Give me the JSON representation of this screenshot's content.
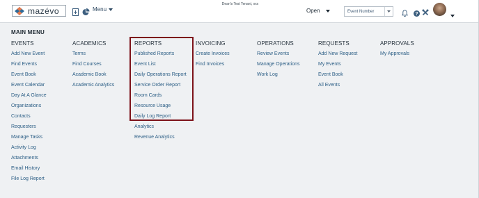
{
  "header": {
    "logo_text": "mazévo",
    "menu_label": "Menu",
    "tenant": "Dean's Test Tenant, xxx",
    "status_value": "Open",
    "search_placeholder": "Event Number"
  },
  "colors": {
    "link": "#2d5f86",
    "highlight": "#7d1219",
    "logo_orange": "#e8794a",
    "logo_blue": "#2e6c9a"
  },
  "main_menu": {
    "title": "MAIN MENU",
    "columns": [
      {
        "heading": "EVENTS",
        "items": [
          "Add New Event",
          "Find Events",
          "Event Book",
          "Event Calendar",
          "Day At A Glance",
          "Organizations",
          "Contacts",
          "Requesters",
          "Manage Tasks",
          "Activity Log",
          "Attachments",
          "Email History",
          "File Log Report"
        ]
      },
      {
        "heading": "ACADEMICS",
        "items": [
          "Terms",
          "Find Courses",
          "Academic Book",
          "Academic Analytics"
        ]
      },
      {
        "heading": "REPORTS",
        "items": [
          "Published Reports",
          "Event List",
          "Daily Operations Report",
          "Service Order Report",
          "Room Cards",
          "Resource Usage",
          "Daily Log Report",
          "Analytics",
          "Revenue Analytics"
        ]
      },
      {
        "heading": "INVOICING",
        "items": [
          "Create Invoices",
          "Find Invoices"
        ]
      },
      {
        "heading": "OPERATIONS",
        "items": [
          "Review Events",
          "Manage Operations",
          "Work Log"
        ]
      },
      {
        "heading": "REQUESTS",
        "items": [
          "Add New Request",
          "My Events",
          "Event Book",
          "All Events"
        ]
      },
      {
        "heading": "APPROVALS",
        "items": [
          "My Approvals"
        ]
      }
    ]
  }
}
